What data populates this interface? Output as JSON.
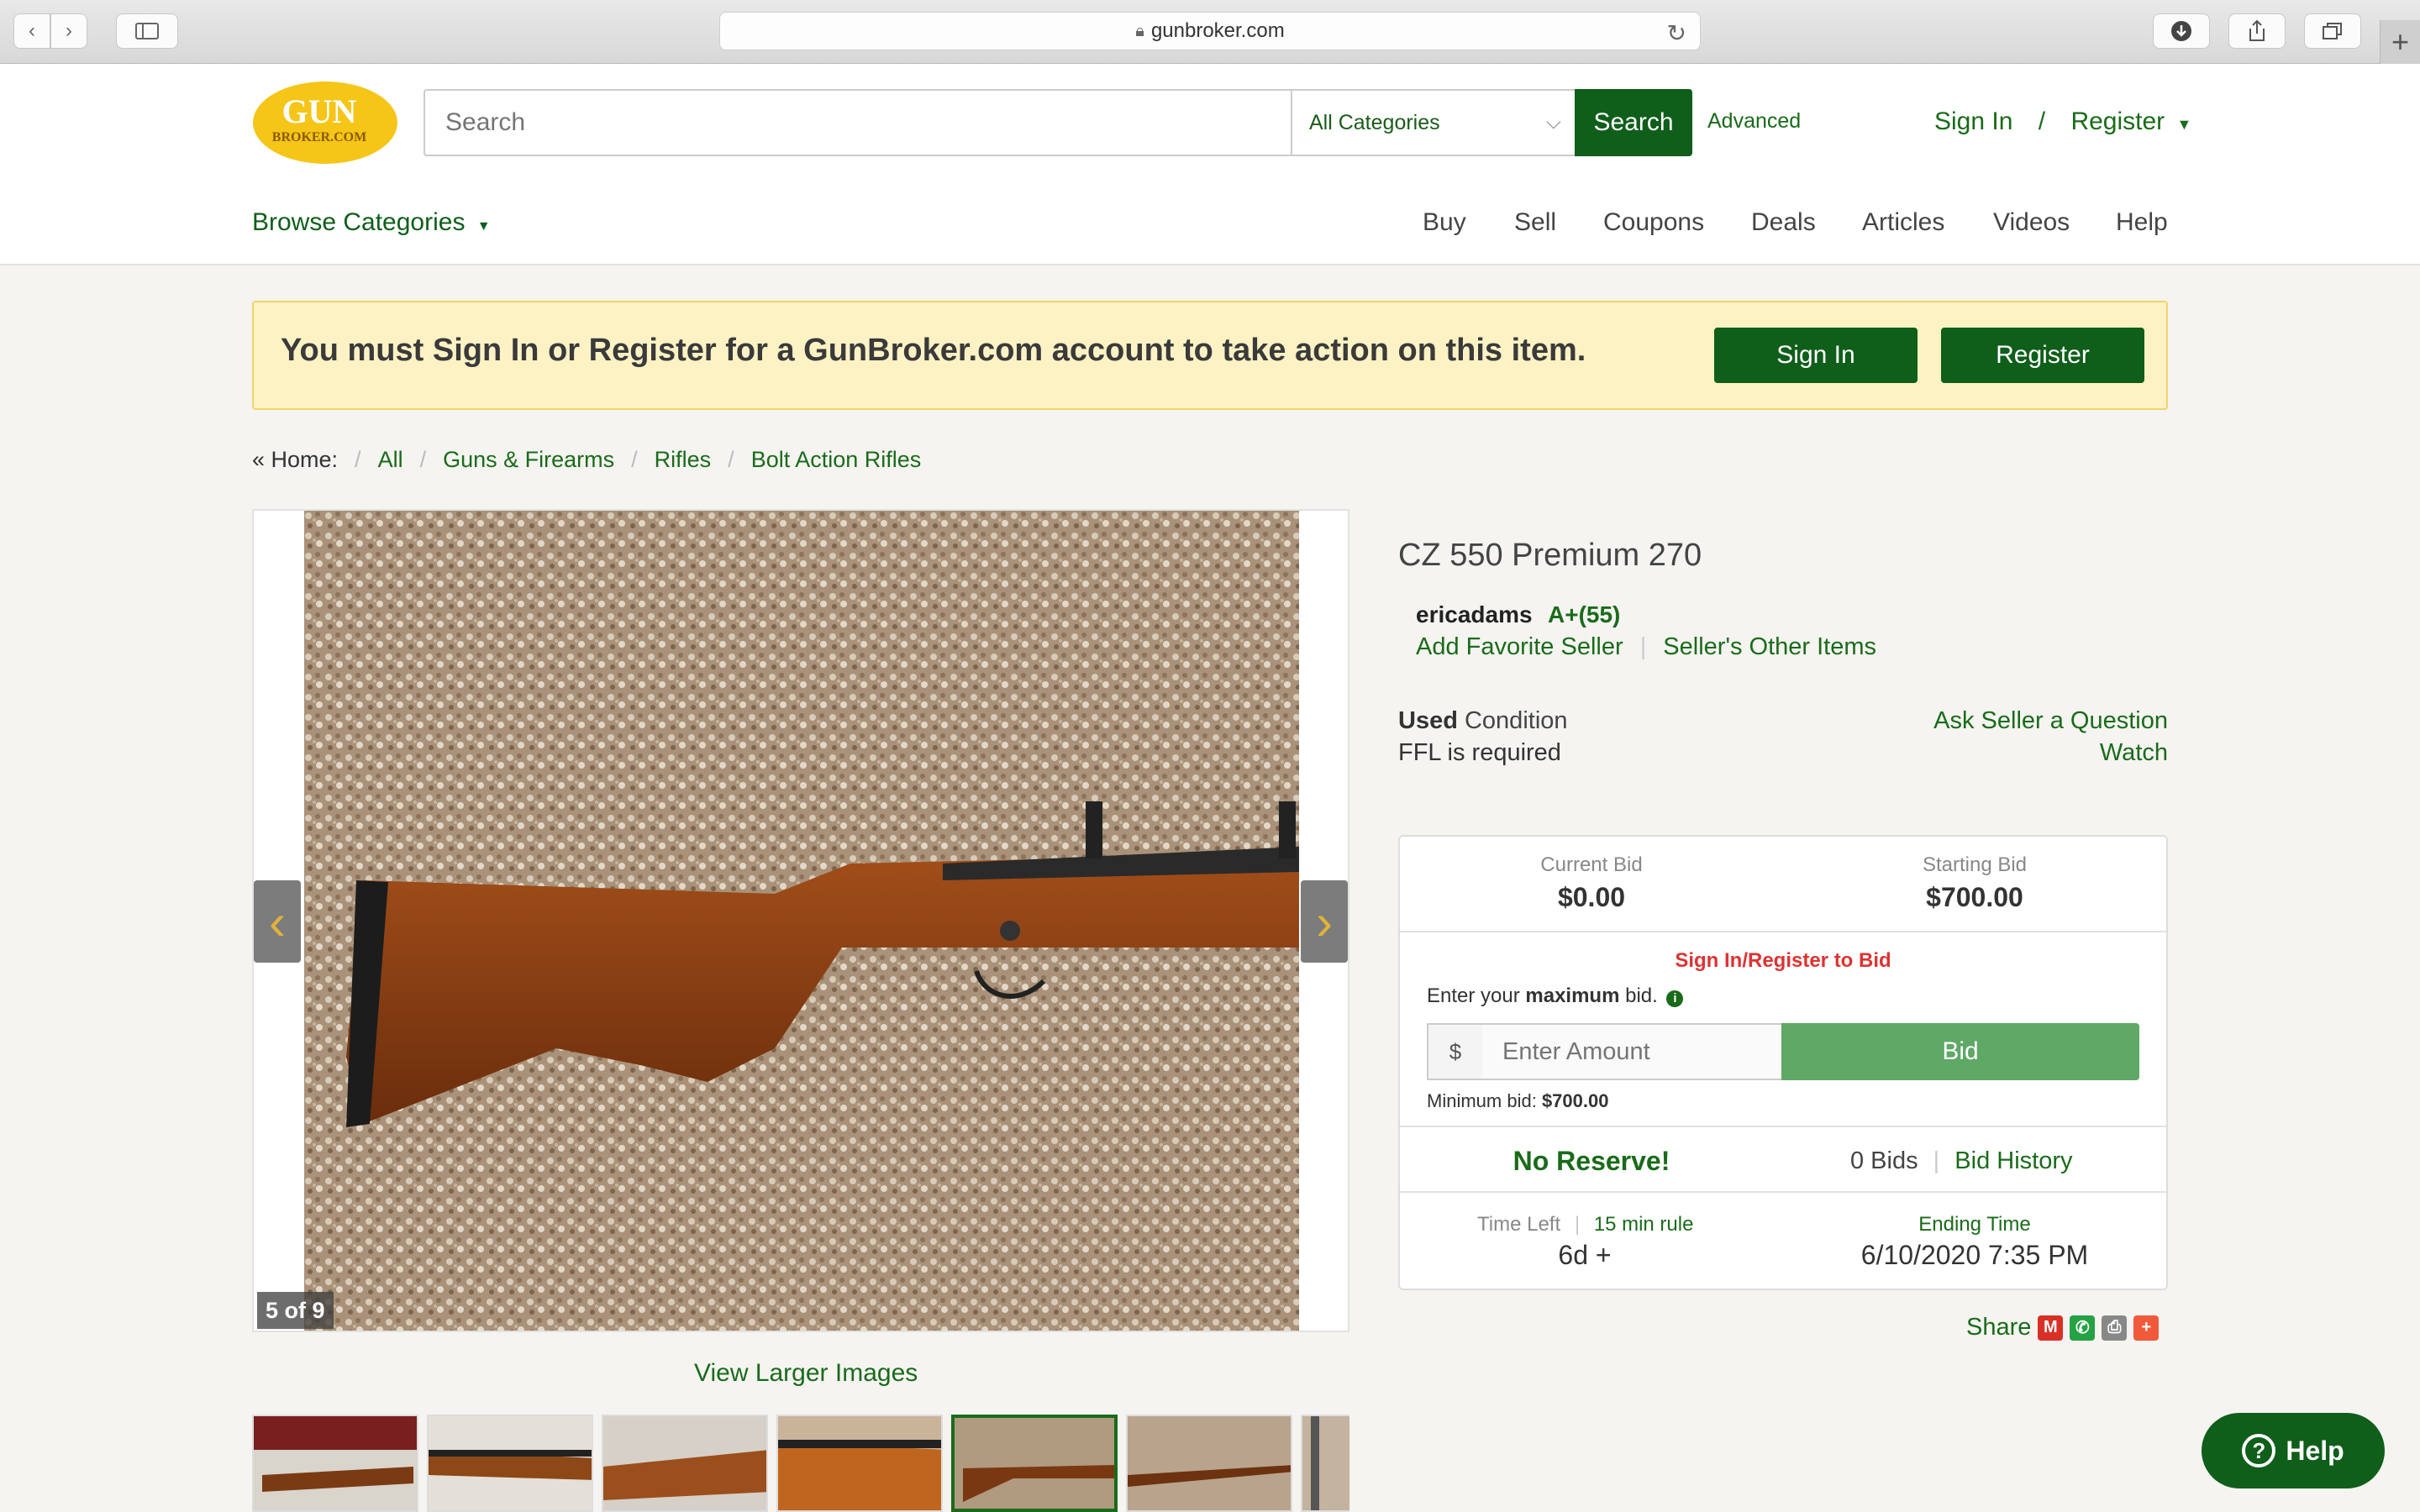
{
  "browser": {
    "url": "gunbroker.com"
  },
  "header": {
    "logo_top": "GUN",
    "logo_bottom": "BROKER.COM",
    "search_placeholder": "Search",
    "category": "All Categories",
    "search_button": "Search",
    "advanced": "Advanced",
    "sign_in": "Sign In",
    "slash": "/",
    "register": "Register",
    "browse_categories": "Browse Categories",
    "nav": [
      "Buy",
      "Sell",
      "Coupons",
      "Deals",
      "Articles",
      "Videos",
      "Help"
    ]
  },
  "banner": {
    "message": "You must Sign In or Register for a GunBroker.com account to take action on this item.",
    "sign_in": "Sign In",
    "register": "Register"
  },
  "breadcrumb": {
    "home": "« Home:",
    "items": [
      "All",
      "Guns & Firearms",
      "Rifles",
      "Bolt Action Rifles"
    ],
    "separator": "/"
  },
  "gallery": {
    "counter": "5 of 9",
    "view_larger": "View Larger Images"
  },
  "item": {
    "title": "CZ 550 Premium 270",
    "seller": "ericadams",
    "rating": "A+(55)",
    "add_favorite": "Add Favorite Seller",
    "link_sep": "|",
    "other_items": "Seller's Other Items",
    "condition_bold": "Used",
    "condition_label": "Condition",
    "ffl": "FFL is required",
    "ask": "Ask Seller a Question",
    "watch": "Watch"
  },
  "bidbox": {
    "current_bid_label": "Current Bid",
    "current_bid": "$0.00",
    "starting_bid_label": "Starting Bid",
    "starting_bid": "$700.00",
    "signin_to_bid": "Sign In/Register to Bid",
    "enter_pre": "Enter your ",
    "enter_bold": "maximum",
    "enter_post": " bid.",
    "dollar": "$",
    "amount_placeholder": "Enter Amount",
    "bid_button": "Bid",
    "min_bid_label": "Minimum bid:",
    "min_bid": "$700.00",
    "no_reserve": "No Reserve!",
    "bids_count": "0 Bids",
    "bid_history": "Bid History",
    "time_left_label": "Time Left",
    "rule": "15 min rule",
    "time_left": "6d +",
    "ending_label": "Ending Time",
    "ending_time": "6/10/2020 7:35 PM"
  },
  "share": {
    "label": "Share"
  },
  "help": {
    "label": "Help"
  },
  "colors": {
    "brand_green": "#0f5e1a",
    "link_green": "#1a6b1a",
    "bid_green": "#5fa866",
    "banner_bg": "#fdf2c4",
    "logo_yellow": "#f5c518"
  }
}
